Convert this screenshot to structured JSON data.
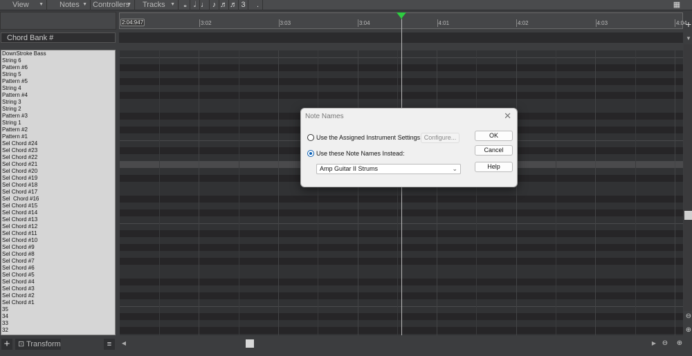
{
  "menubar": {
    "items": [
      "View",
      "Notes",
      "Controllers",
      "Tracks"
    ],
    "durations": [
      "whole-note",
      "half-note",
      "quarter-note",
      "eighth-note",
      "sixteenth-note",
      "thirtysecond-note",
      "triplet",
      "dot"
    ],
    "triplet_label": "3",
    "dot_label": "."
  },
  "ruler": {
    "now": "2:04:947",
    "ticks": [
      "3:02",
      "3:03",
      "3:04",
      "4:01",
      "4:02",
      "4:03",
      "4:04"
    ]
  },
  "chord_bank_label": "Chord Bank #",
  "note_names": [
    "DownStroke Bass",
    "String 6",
    "Pattern #6",
    "String 5",
    "Pattern #5",
    "String 4",
    "Pattern #4",
    "String 3",
    "String 2",
    "Pattern #3",
    "String 1",
    "Pattern #2",
    "Pattern #1",
    "Sel Chord #24",
    "Sel Chord #23",
    "Sel Chord #22",
    "Sel Chord #21",
    "Sel Chord #20",
    "Sel Chord #19",
    "Sel Chord #18",
    "Sel Chord #17",
    "Sel  Chord #16",
    "Sel Chord #15",
    "Sel Chord #14",
    "Sel Chord #13",
    "Sel Chord #12",
    "Sel Chord #11",
    "Sel Chord #10",
    "Sel Chord #9",
    "Sel Chord #8",
    "Sel Chord #7",
    "Sel Chord #6",
    "Sel Chord #5",
    "Sel Chord #4",
    "Sel Chord #3",
    "Sel Chord #2",
    "Sel Chord #1",
    "35",
    "34",
    "33",
    "32"
  ],
  "bottom": {
    "transform_label": "Transform"
  },
  "dialog": {
    "title": "Note Names",
    "option1": "Use the Assigned Instrument Settings",
    "option2": "Use these Note Names Instead:",
    "selected_option": 2,
    "configure": "Configure...",
    "dropdown_value": "Amp Guitar II Strums",
    "ok": "OK",
    "cancel": "Cancel",
    "help": "Help"
  },
  "colors": {
    "playhead": "#2ecc40",
    "dialog_accent": "#0a5fb4"
  }
}
